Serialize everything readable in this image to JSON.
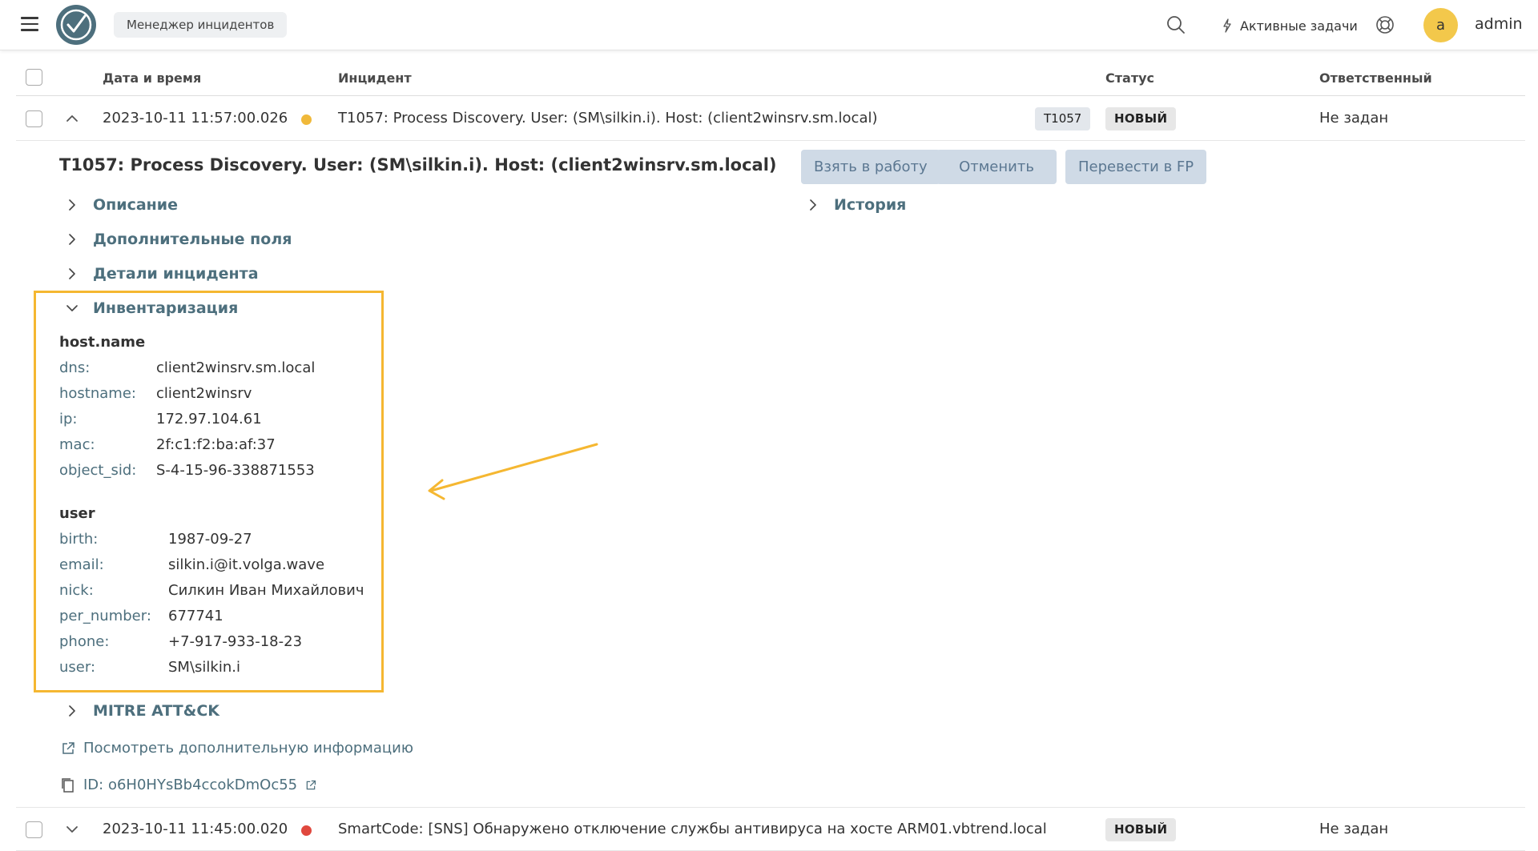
{
  "header": {
    "app_title": "Менеджер инцидентов",
    "tasks_label": "Активные задачи",
    "avatar_letter": "a",
    "username": "admin",
    "accent": "#4d6f7d"
  },
  "table": {
    "columns": [
      "Дата и время",
      "Инцидент",
      "Статус",
      "Ответственный"
    ],
    "rows": [
      {
        "datetime": "2023-10-11 11:57:00.026",
        "severity_color": "#f0b93a",
        "incident": "T1057: Process Discovery. User: (SM\\silkin.i). Host: (client2winsrv.sm.local)",
        "tag": "T1057",
        "status": "НОВЫЙ",
        "assignee": "Не задан",
        "expanded": true
      },
      {
        "datetime": "2023-10-11 11:45:00.020",
        "severity_color": "#e0483e",
        "incident": "SmartCode: [SNS] Обнаружено отключение службы антивируса на хосте ARM01.vbtrend.local",
        "status": "НОВЫЙ",
        "assignee": "Не задан",
        "expanded": false
      }
    ]
  },
  "detail": {
    "title": "T1057: Process Discovery. User: (SM\\silkin.i). Host: (client2winsrv.sm.local)",
    "buttons": [
      "Взять в работу",
      "Отменить",
      "Перевести в FP"
    ],
    "sections": {
      "description": "Описание",
      "extra_fields": "Дополнительные поля",
      "incident_details": "Детали инцидента",
      "inventory": "Инвентаризация",
      "mitre": "MITRE ATT&CK",
      "history": "История"
    },
    "inventory": {
      "host_group": "host.name",
      "host_fields": [
        {
          "k": "dns:",
          "v": "client2winsrv.sm.local"
        },
        {
          "k": "hostname:",
          "v": "client2winsrv"
        },
        {
          "k": "ip:",
          "v": "172.97.104.61"
        },
        {
          "k": "mac:",
          "v": "2f:c1:f2:ba:af:37"
        },
        {
          "k": "object_sid:",
          "v": "S-4-15-96-338871553"
        }
      ],
      "user_group": "user",
      "user_fields": [
        {
          "k": "birth:",
          "v": "1987-09-27"
        },
        {
          "k": "email:",
          "v": "silkin.i@it.volga.wave"
        },
        {
          "k": "nick:",
          "v": "Силкин Иван Михайлович"
        },
        {
          "k": "per_number:",
          "v": "677741"
        },
        {
          "k": "phone:",
          "v": "+7-917-933-18-23"
        },
        {
          "k": "user:",
          "v": "SM\\silkin.i"
        }
      ],
      "highlight_color": "#f5b731"
    },
    "more_info_link": "Посмотреть дополнительную информацию",
    "id_text": "ID: o6H0HYsBb4ccokDmOc55"
  }
}
